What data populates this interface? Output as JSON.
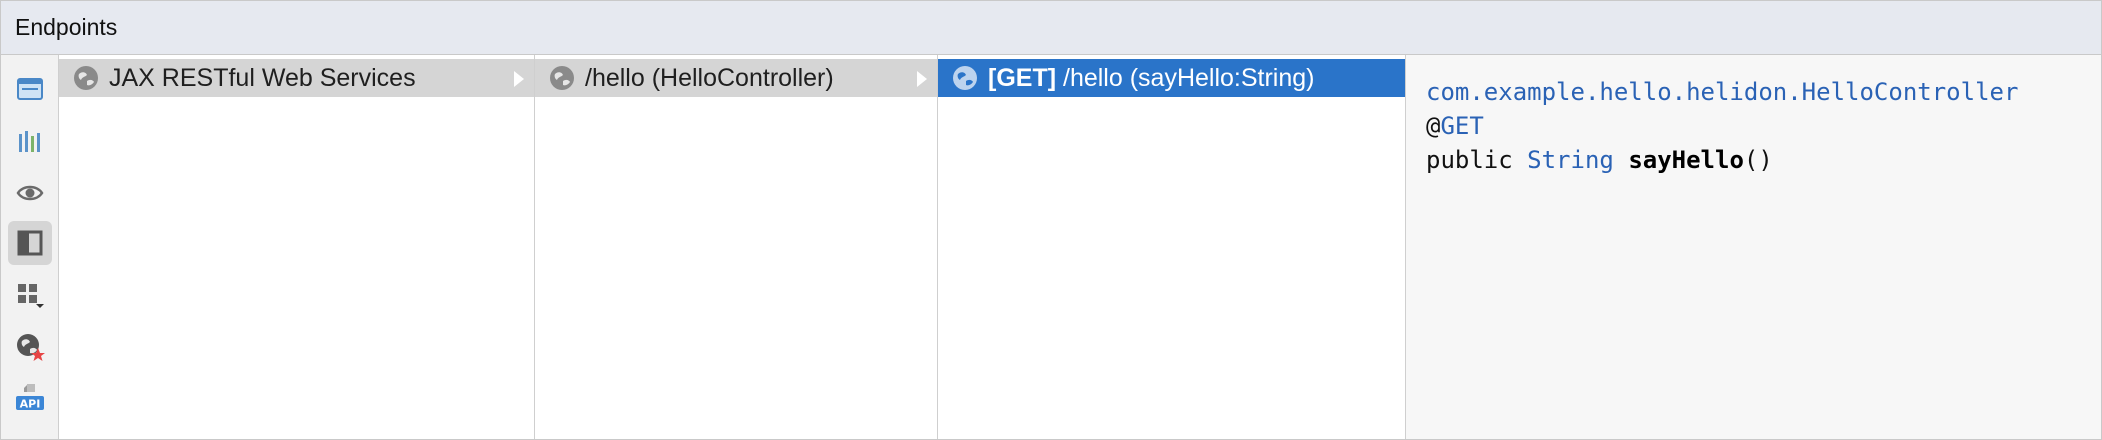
{
  "window": {
    "title": "Endpoints"
  },
  "toolbar": {
    "buttons": [
      {
        "icon": "preview-layout-icon"
      },
      {
        "icon": "bar-chart-icon"
      },
      {
        "icon": "eye-icon"
      },
      {
        "icon": "panel-toggle-icon",
        "active": true
      },
      {
        "icon": "group-by-icon"
      },
      {
        "icon": "web-service-icon"
      },
      {
        "icon": "api-icon",
        "text": "API"
      }
    ]
  },
  "columns": {
    "frameworks": {
      "items": [
        {
          "label": "JAX RESTful Web Services"
        }
      ]
    },
    "paths": {
      "items": [
        {
          "label": "/hello (HelloController)"
        }
      ]
    },
    "endpoints": {
      "items": [
        {
          "method": "[GET]",
          "label": "/hello (sayHello:String)"
        }
      ]
    }
  },
  "details": {
    "class_name": "com.example.hello.helidon.HelloController",
    "annotation_at": "@",
    "annotation_name": "GET",
    "modifier": "public",
    "return_type": "String",
    "method_name": "sayHello",
    "parens": "()"
  },
  "colors": {
    "selection": "#2a74c9",
    "row_highlight": "#d5d5d5",
    "code_type": "#2a62b5",
    "title_bar": "#e6e9f0"
  }
}
